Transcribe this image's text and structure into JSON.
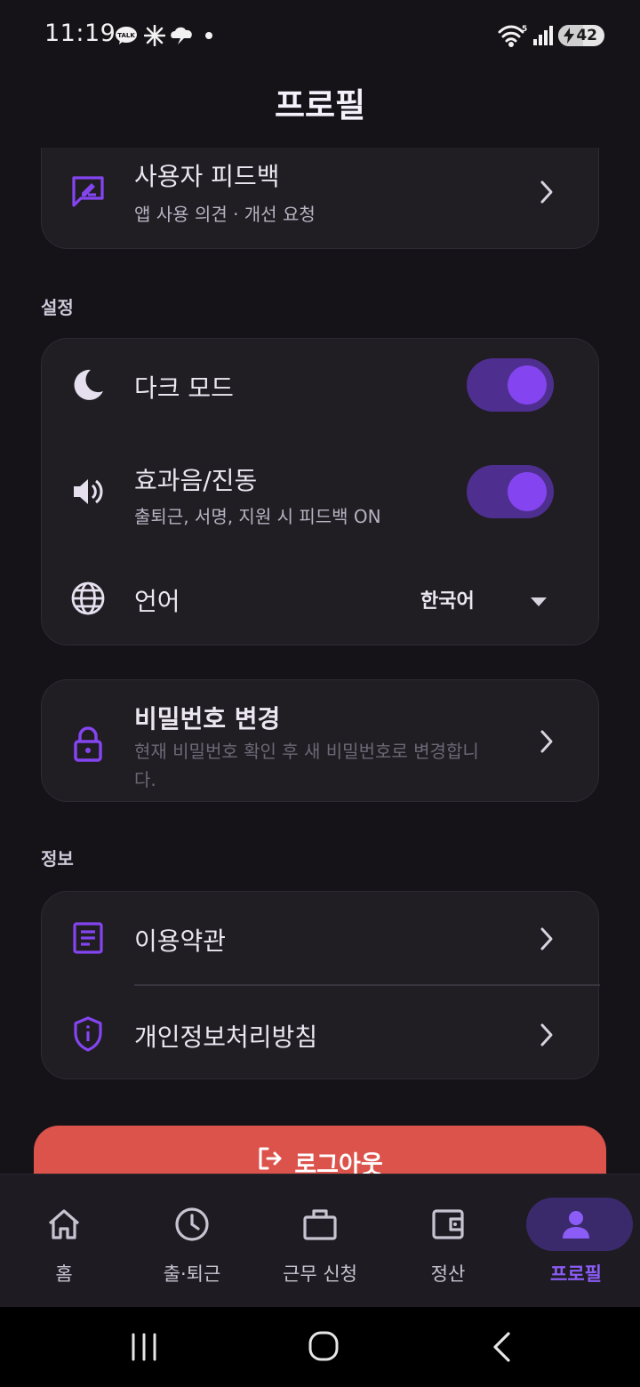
{
  "status_bar": {
    "time": "11:19",
    "battery_level": "42",
    "notification_icons": [
      "talk-icon",
      "sparkle-icon",
      "chat-cloud-icon",
      "dot-icon"
    ],
    "system_icons": [
      "wifi-icon",
      "signal-icon",
      "battery-icon"
    ]
  },
  "header": {
    "title": "프로필"
  },
  "feedback_card": {
    "title": "사용자 피드백",
    "subtitle": "앱 사용 의견 · 개선 요청",
    "icon": "feedback-edit-icon"
  },
  "settings_section": {
    "label": "설정",
    "dark_mode": {
      "label": "다크 모드",
      "enabled": true,
      "icon": "moon-icon"
    },
    "sound_vibration": {
      "label": "효과음/진동",
      "subtitle": "출퇴근, 서명, 지원 시 피드백 ON",
      "enabled": true,
      "icon": "speaker-icon"
    },
    "language": {
      "label": "언어",
      "value": "한국어",
      "icon": "globe-icon"
    }
  },
  "password_card": {
    "title": "비밀번호 변경",
    "subtitle_line1": "현재 비밀번호 확인 후 새 비밀번호로 변경합니",
    "subtitle_line2": "다.",
    "icon": "lock-icon"
  },
  "info_section": {
    "label": "정보",
    "items": [
      {
        "label": "이용약관",
        "icon": "document-icon"
      },
      {
        "label": "개인정보처리방침",
        "icon": "shield-info-icon"
      }
    ]
  },
  "logout": {
    "label": "로그아웃",
    "icon": "logout-icon"
  },
  "bottom_nav": {
    "items": [
      {
        "label": "홈",
        "icon": "home-icon",
        "active": false
      },
      {
        "label": "출·퇴근",
        "icon": "clock-icon",
        "active": false
      },
      {
        "label": "근무 신청",
        "icon": "briefcase-icon",
        "active": false
      },
      {
        "label": "정산",
        "icon": "wallet-icon",
        "active": false
      },
      {
        "label": "프로필",
        "icon": "person-icon",
        "active": true
      }
    ]
  },
  "colors": {
    "background": "#151218",
    "card": "#201D23",
    "accent": "#8445F0",
    "toggle_track": "#4E2F8F",
    "logout": "#DB534B",
    "active_nav": "#8B5CF6"
  }
}
